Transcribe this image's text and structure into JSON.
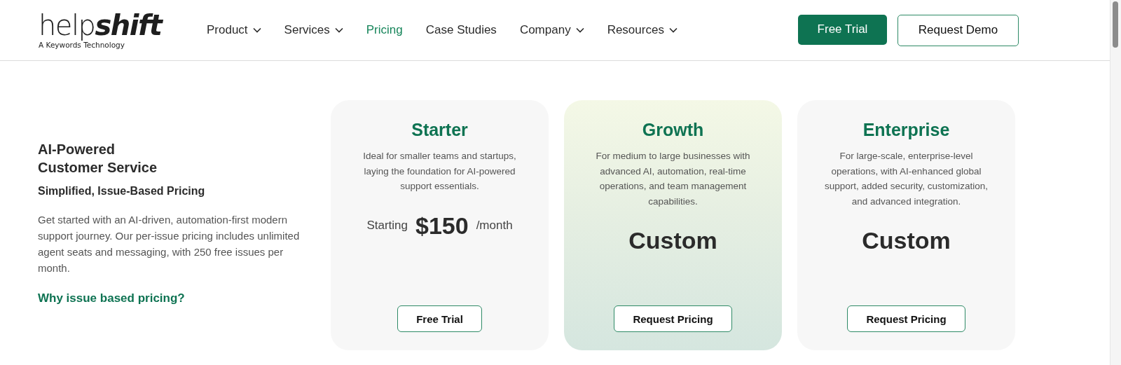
{
  "header": {
    "logo": "help**shift**",
    "tagline": "A Keywords Technology",
    "nav": [
      {
        "label": "Product",
        "dropdown": true,
        "selected": false
      },
      {
        "label": "Services",
        "dropdown": true,
        "selected": false
      },
      {
        "label": "Pricing",
        "dropdown": false,
        "selected": true
      },
      {
        "label": "Case Studies",
        "dropdown": false,
        "selected": false
      },
      {
        "label": "Company",
        "dropdown": true,
        "selected": false
      },
      {
        "label": "Resources",
        "dropdown": true,
        "selected": false
      }
    ],
    "buttons": [
      {
        "label": "Free Trial",
        "kind": "primary"
      },
      {
        "label": "Request Demo",
        "kind": "outline"
      }
    ]
  },
  "intro": {
    "title_lines": [
      "AI-Powered",
      "Customer Service"
    ],
    "subtitle": "Simplified, Issue-Based Pricing",
    "body": "Get started with an AI-driven, automation-first modern support journey. Our per-issue pricing includes unlimited agent seats and messaging, with 250 free issues per month.",
    "link": "Why issue based pricing?"
  },
  "plans": [
    {
      "name": "Starter",
      "featured": false,
      "description": "Ideal for smaller teams and startups, laying the foundation for AI-powered support essentials.",
      "price": {
        "kind": "starting",
        "prefix": "Starting",
        "amount": "$150",
        "suffix": "/month"
      },
      "button": "Free Trial"
    },
    {
      "name": "Growth",
      "featured": true,
      "description": "For medium to large businesses with advanced AI, automation, real-time operations, and team management capabilities.",
      "price": {
        "kind": "custom",
        "amount": "Custom"
      },
      "button": "Request Pricing"
    },
    {
      "name": "Enterprise",
      "featured": false,
      "description": "For large-scale, enterprise-level operations, with AI-enhanced global support, added security, customization, and advanced integration.",
      "price": {
        "kind": "custom",
        "amount": "Custom"
      },
      "button": "Request Pricing"
    }
  ]
}
